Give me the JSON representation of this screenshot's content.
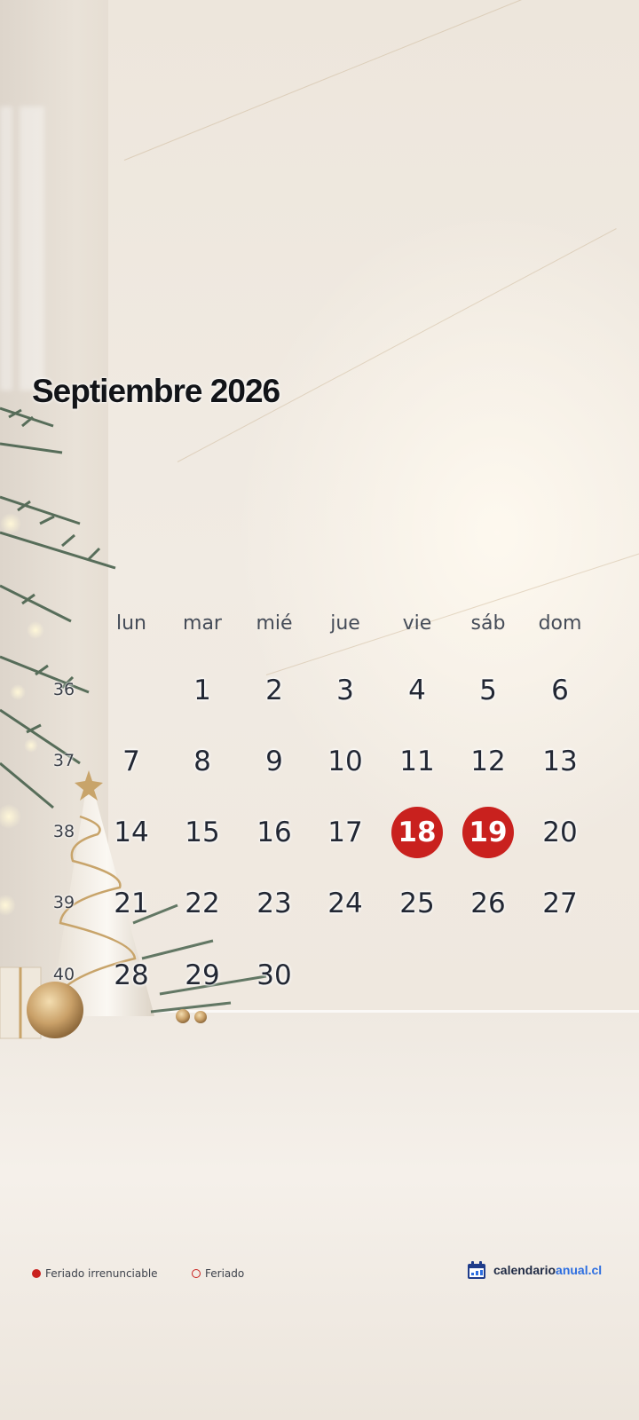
{
  "calendar": {
    "title": "Septiembre 2026",
    "weekdays": [
      "lun",
      "mar",
      "mié",
      "jue",
      "vie",
      "sáb",
      "dom"
    ],
    "weeks": [
      {
        "number": "36",
        "days": [
          "",
          "1",
          "2",
          "3",
          "4",
          "5",
          "6"
        ]
      },
      {
        "number": "37",
        "days": [
          "7",
          "8",
          "9",
          "10",
          "11",
          "12",
          "13"
        ]
      },
      {
        "number": "38",
        "days": [
          "14",
          "15",
          "16",
          "17",
          "18",
          "19",
          "20"
        ]
      },
      {
        "number": "39",
        "days": [
          "21",
          "22",
          "23",
          "24",
          "25",
          "26",
          "27"
        ]
      },
      {
        "number": "40",
        "days": [
          "28",
          "29",
          "30",
          "",
          "",
          "",
          ""
        ]
      }
    ],
    "holidays_irrenunciable": [
      "18",
      "19"
    ]
  },
  "legend": {
    "irrenunciable_label": "Feriado irrenunciable",
    "feriado_label": "Feriado",
    "irrenunciable_color": "#c9211e",
    "feriado_color": "#c9211e"
  },
  "brand": {
    "name_part1": "calendario",
    "name_part2": "anual.cl",
    "icon": "calendar-icon",
    "accent_color": "#2d6ee0"
  }
}
